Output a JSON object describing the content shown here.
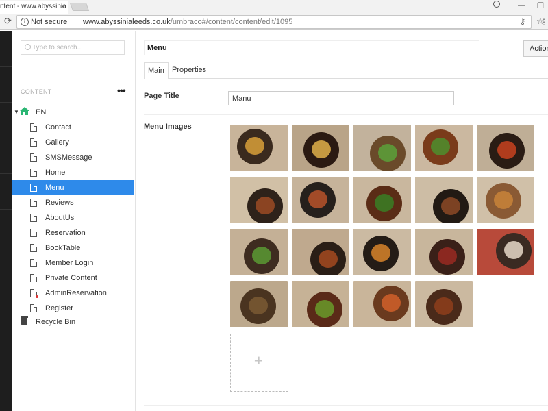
{
  "browser": {
    "tab_title": "ntent - www.abyssinia",
    "tab_close": "×",
    "security_label": "Not secure",
    "url_host": "www.abyssinialeeds.co.uk",
    "url_path": "/umbraco#/content/content/edit/1095",
    "min_glyph": "—",
    "max_glyph": "❐",
    "menu_glyph": "⋮"
  },
  "tree": {
    "search_placeholder": "Type to search...",
    "section_title": "CONTENT",
    "section_menu": "•••",
    "root_label": "EN",
    "items": [
      {
        "label": "Contact"
      },
      {
        "label": "Gallery"
      },
      {
        "label": "SMSMessage"
      },
      {
        "label": "Home"
      },
      {
        "label": "Menu",
        "active": true
      },
      {
        "label": "Reviews"
      },
      {
        "label": "AboutUs"
      },
      {
        "label": "Reservation"
      },
      {
        "label": "BookTable"
      },
      {
        "label": "Member Login"
      },
      {
        "label": "Private Content"
      },
      {
        "label": "AdminReservation"
      },
      {
        "label": "Register"
      }
    ],
    "recycle_bin": "Recycle Bin"
  },
  "editor": {
    "node_name": "Menu",
    "actions_label": "Action",
    "tabs": [
      {
        "label": "Main"
      },
      {
        "label": "Properties"
      }
    ],
    "page_title_label": "Page Title",
    "page_title_value": "Manu",
    "menu_images_label": "Menu Images",
    "add_symbol": "+",
    "image_count": 19
  },
  "colors": {
    "accent": "#2e8aea",
    "home_green": "#2bb673",
    "rail": "#1e1e1e"
  }
}
